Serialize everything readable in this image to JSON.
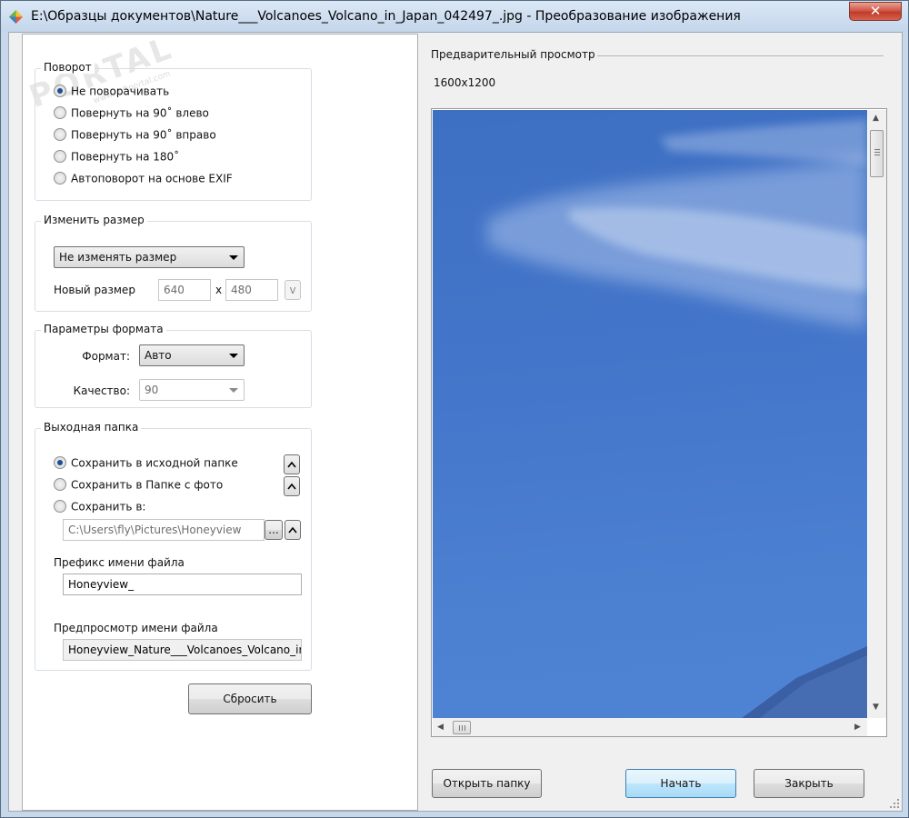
{
  "window": {
    "title": "E:\\Образцы документов\\Nature___Volcanoes_Volcano_in_Japan_042497_.jpg - Преобразование изображения",
    "close_label": "✕",
    "app_icon": "honeyview-app-icon"
  },
  "watermark": {
    "text": "PORTAL",
    "subtext": "www.softportal.com"
  },
  "rotation": {
    "title": "Поворот",
    "options": [
      {
        "label": "Не поворачивать",
        "selected": true
      },
      {
        "label": "Повернуть на 90˚ влево",
        "selected": false
      },
      {
        "label": "Повернуть на 90˚ вправо",
        "selected": false
      },
      {
        "label": "Повернуть на 180˚",
        "selected": false
      },
      {
        "label": "Автоповорот на основе EXIF",
        "selected": false
      }
    ]
  },
  "resize": {
    "title": "Изменить размер",
    "mode_selected": "Не изменять размер",
    "new_size_label": "Новый размер",
    "width": "640",
    "separator": "x",
    "height": "480",
    "preset_label": "v"
  },
  "format": {
    "title": "Параметры формата",
    "format_label": "Формат:",
    "format_selected": "Авто",
    "quality_label": "Качество:",
    "quality_selected": "90"
  },
  "output": {
    "title": "Выходная папка",
    "options": [
      {
        "label": "Сохранить в исходной папке",
        "selected": true
      },
      {
        "label": "Сохранить в Папке с фото",
        "selected": false
      },
      {
        "label": "Сохранить в:",
        "selected": false
      }
    ],
    "path_value": "C:\\Users\\fly\\Pictures\\Honeyview",
    "browse_label": "...",
    "prefix_label": "Префикс имени файла",
    "prefix_value": "Honeyview_",
    "filename_preview_label": "Предпросмотр имени файла",
    "filename_preview_value": "Honeyview_Nature___Volcanoes_Volcano_in"
  },
  "reset_label": "Сбросить",
  "preview": {
    "title": "Предварительный просмотр",
    "size": "1600x1200"
  },
  "buttons": {
    "open_folder": "Открыть папку",
    "start": "Начать",
    "close": "Закрыть"
  },
  "icons": {
    "spin_up": "chevron-up-icon",
    "scroll_up": "▲",
    "scroll_down": "▼",
    "scroll_left": "◀",
    "scroll_right": "▶"
  },
  "colors": {
    "sky": "#4375ca",
    "default_button": "#a7d9f5",
    "close_button": "#c13b29"
  }
}
